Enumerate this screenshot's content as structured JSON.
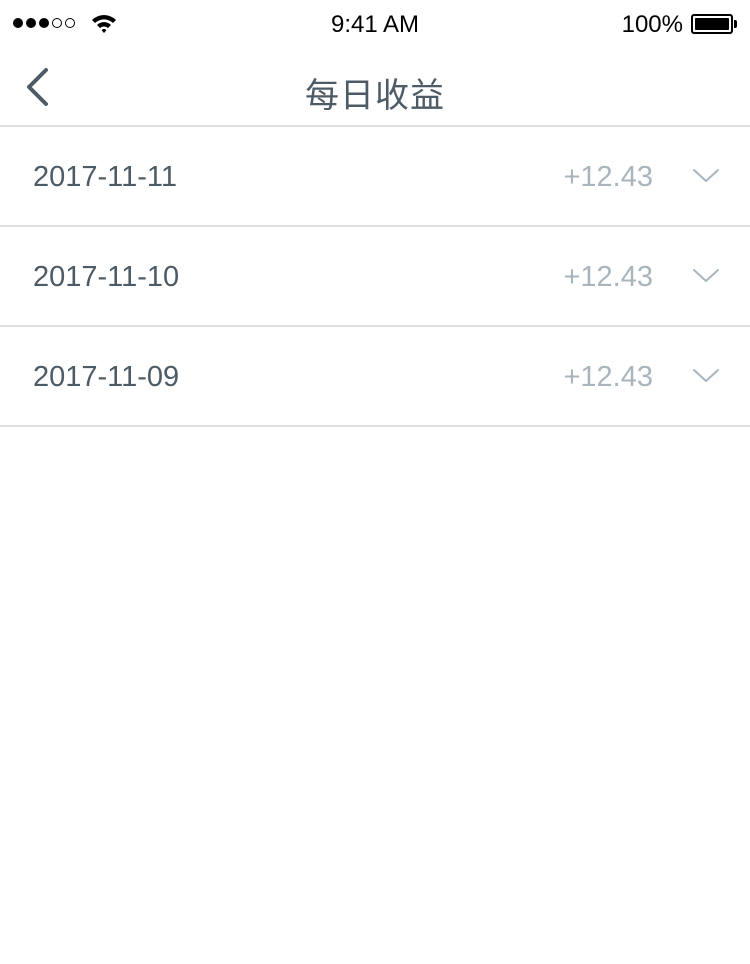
{
  "status_bar": {
    "time": "9:41 AM",
    "battery_percent": "100%",
    "signal_strength": 3,
    "signal_total": 5,
    "battery_level": 1.0,
    "icons": [
      "signal-dots-icon",
      "wifi-icon",
      "battery-icon"
    ]
  },
  "nav": {
    "title": "每日收益",
    "back_icon": "chevron-left-icon"
  },
  "earnings": [
    {
      "date": "2017-11-11",
      "amount": "+12.43",
      "icon": "chevron-down-icon"
    },
    {
      "date": "2017-11-10",
      "amount": "+12.43",
      "icon": "chevron-down-icon"
    },
    {
      "date": "2017-11-09",
      "amount": "+12.43",
      "icon": "chevron-down-icon"
    }
  ],
  "colors": {
    "text_primary": "#4d5b66",
    "text_secondary": "#a9b5bd",
    "divider": "#dcdfe2",
    "background": "#ffffff"
  }
}
